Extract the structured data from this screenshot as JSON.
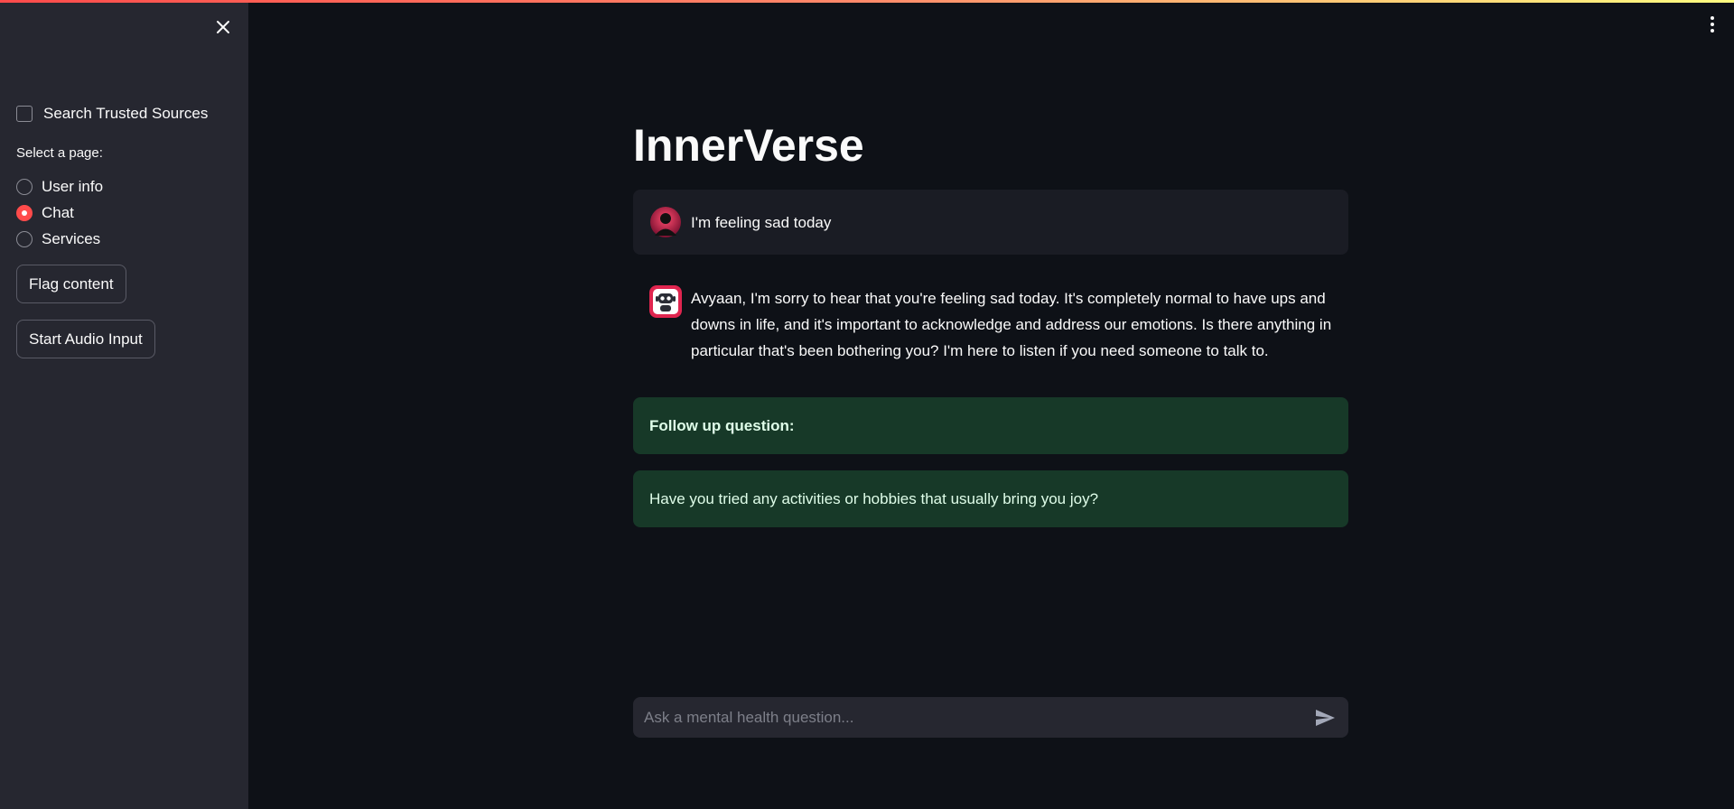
{
  "app": {
    "title": "InnerVerse"
  },
  "sidebar": {
    "search_trusted_sources_label": "Search Trusted Sources",
    "search_trusted_sources_checked": false,
    "radio_label": "Select a page:",
    "pages": [
      {
        "label": "User info",
        "selected": false
      },
      {
        "label": "Chat",
        "selected": true
      },
      {
        "label": "Services",
        "selected": false
      }
    ],
    "flag_button_label": "Flag content",
    "audio_button_label": "Start Audio Input"
  },
  "chat": {
    "user_message": "I'm feeling sad today",
    "assistant_message": "Avyaan, I'm sorry to hear that you're feeling sad today. It's completely normal to have ups and downs in life, and it's important to acknowledge and address our emotions. Is there anything in particular that's been bothering you? I'm here to listen if you need someone to talk to.",
    "follow_up_heading": "Follow up question:",
    "follow_up_question": "Have you tried any activities or hobbies that usually bring you joy?",
    "input_placeholder": "Ask a mental health question..."
  },
  "icons": {
    "close": "close-icon",
    "menu": "kebab-menu-icon",
    "user_avatar": "user-avatar-icon",
    "assistant_avatar": "robot-avatar-icon",
    "send": "send-icon"
  },
  "colors": {
    "accent": "#ff4b4b",
    "background": "#0e1117",
    "sidebar": "#262730",
    "success_box": "#173928"
  }
}
